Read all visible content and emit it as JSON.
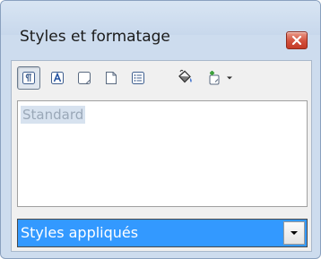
{
  "window": {
    "title": "Styles et formatage",
    "close_icon": "close-icon"
  },
  "toolbar": {
    "buttons": [
      {
        "name": "paragraph-styles",
        "icon": "paragraph-styles-icon",
        "active": true
      },
      {
        "name": "character-styles",
        "icon": "character-styles-icon",
        "active": false
      },
      {
        "name": "frame-styles",
        "icon": "frame-styles-icon",
        "active": false
      },
      {
        "name": "page-styles",
        "icon": "page-styles-icon",
        "active": false
      },
      {
        "name": "list-styles",
        "icon": "list-styles-icon",
        "active": false
      },
      {
        "name": "fill-format-mode",
        "icon": "paint-bucket-icon",
        "active": false
      },
      {
        "name": "new-style-from-selection",
        "icon": "new-style-icon",
        "active": false
      }
    ]
  },
  "style_list": {
    "items": [
      "Standard"
    ]
  },
  "filter": {
    "selected": "Styles appliqués"
  },
  "colors": {
    "selection": "#3399ff",
    "accent_red": "#d2503c"
  }
}
